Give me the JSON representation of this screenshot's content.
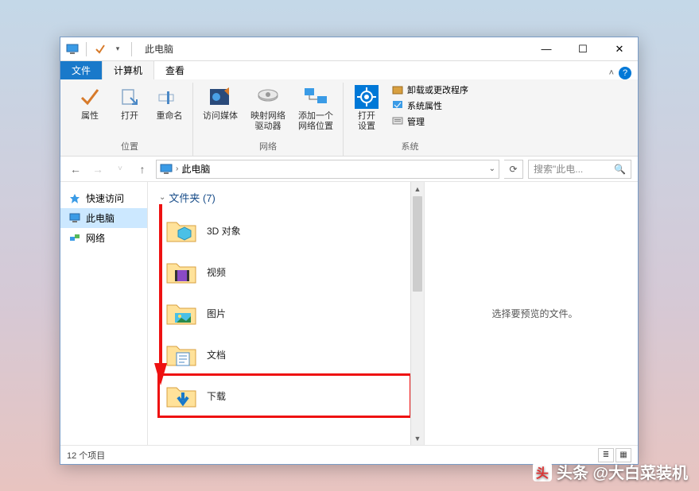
{
  "title": "此电脑",
  "tabs": {
    "file": "文件",
    "computer": "计算机",
    "view": "查看"
  },
  "ribbon": {
    "location": {
      "properties": "属性",
      "open": "打开",
      "rename": "重命名",
      "group": "位置"
    },
    "network": {
      "media": "访问媒体",
      "map": "映射网络\n驱动器",
      "addloc": "添加一个\n网络位置",
      "group": "网络"
    },
    "system": {
      "settings": "打开\n设置",
      "uninstall": "卸载或更改程序",
      "sysprop": "系统属性",
      "manage": "管理",
      "group": "系统"
    }
  },
  "addr": {
    "location": "此电脑"
  },
  "search": {
    "placeholder": "搜索\"此电..."
  },
  "nav": {
    "quick": "快速访问",
    "thispc": "此电脑",
    "network": "网络"
  },
  "group_header": "文件夹 (7)",
  "items": [
    "3D 对象",
    "视频",
    "图片",
    "文档",
    "下载"
  ],
  "preview": "选择要预览的文件。",
  "status": "12 个项目",
  "watermark": "头条 @大白菜装机"
}
